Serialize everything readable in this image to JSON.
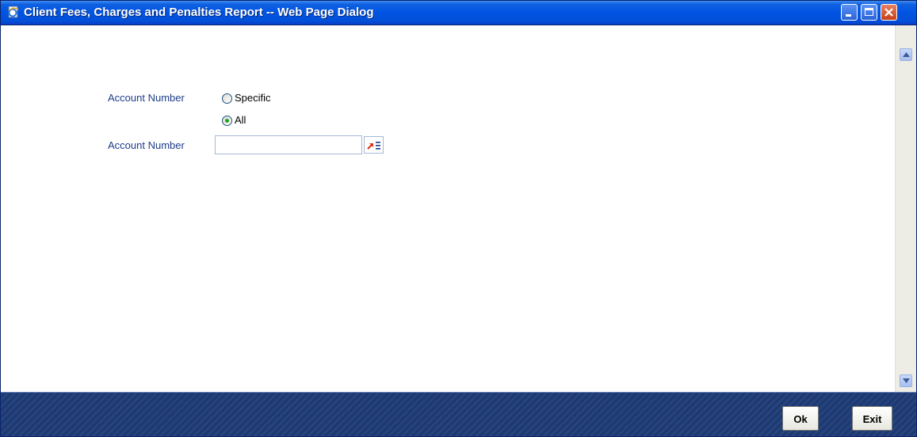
{
  "window": {
    "title": "Client Fees, Charges and Penalties Report -- Web Page Dialog",
    "icon": "ie-page-icon",
    "controls": [
      "minimize-icon",
      "maximize-icon",
      "close-icon"
    ]
  },
  "form": {
    "account_selection_label": "Account Number",
    "options": [
      {
        "label": "Specific",
        "selected": false
      },
      {
        "label": "All",
        "selected": true
      }
    ],
    "account_number_label": "Account Number",
    "account_number_value": "",
    "lov_icon": "list-of-values-icon"
  },
  "footer": {
    "ok_label": "Ok",
    "exit_label": "Exit"
  },
  "colors": {
    "title_bar": "#0054e3",
    "label_text": "#1e3c8c",
    "footer_bg": "#1d3a74",
    "radio_selected": "#21a121"
  }
}
